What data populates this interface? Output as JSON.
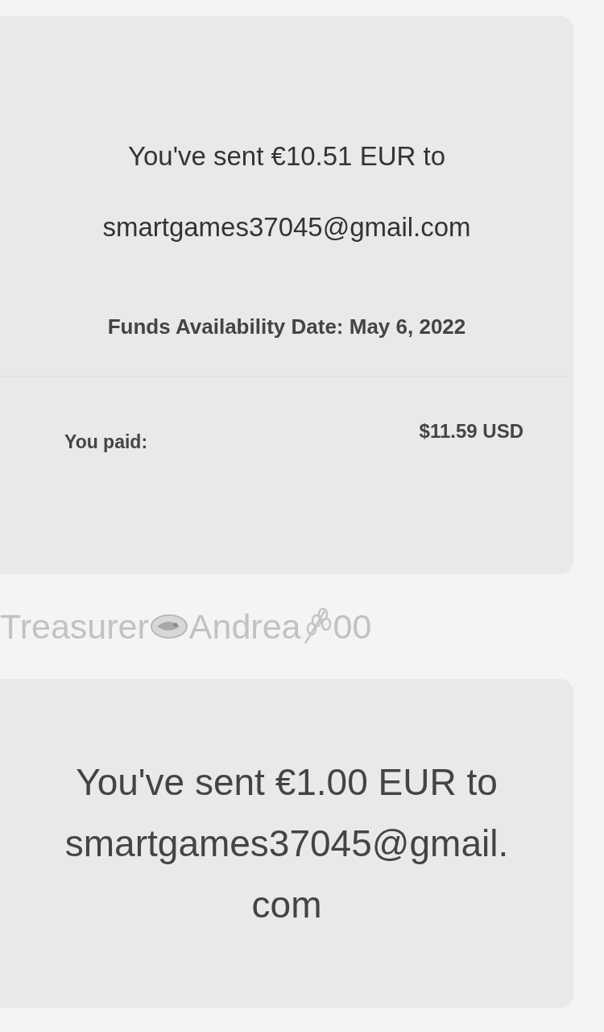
{
  "messages": [
    {
      "kind": "payment",
      "sent_text": "You've sent €10.51 EUR to smartgames37045@gmail.com",
      "funds_text": "Funds Availability Date: May 6, 2022",
      "paid_label": "You paid:",
      "paid_amount": "$11.59 USD"
    },
    {
      "kind": "sender",
      "parts": [
        {
          "kind": "text",
          "text": "Treasurer"
        },
        {
          "kind": "fish"
        },
        {
          "kind": "text",
          "text": "Andrea"
        },
        {
          "kind": "grain"
        },
        {
          "kind": "text",
          "text": "00"
        }
      ]
    },
    {
      "kind": "payment_short",
      "sent_text": "You've sent €1.00 EUR to smartgames37045@gmail.com"
    }
  ]
}
